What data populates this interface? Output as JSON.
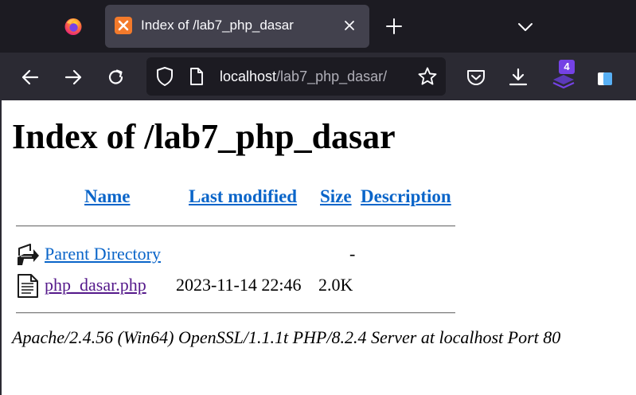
{
  "browser": {
    "tab": {
      "title": "Index of /lab7_php_dasar"
    },
    "url": {
      "host": "localhost",
      "path": "/lab7_php_dasar/"
    },
    "extension_badge": "4"
  },
  "page": {
    "heading": "Index of /lab7_php_dasar",
    "columns": {
      "name": "Name",
      "last_modified": "Last modified",
      "size": "Size",
      "description": "Description"
    },
    "rows": [
      {
        "name": "Parent Directory",
        "last_modified": "",
        "size": "-",
        "icon": "back-folder-icon"
      },
      {
        "name": "php_dasar.php",
        "last_modified": "2023-11-14 22:46",
        "size": "2.0K",
        "icon": "text-file-icon"
      }
    ],
    "address": "Apache/2.4.56 (Win64) OpenSSL/1.1.1t PHP/8.2.4 Server at localhost Port 80"
  },
  "colors": {
    "tabbar_bg": "#1c1b22",
    "navbar_bg": "#2b2a33",
    "link": "#0a65c9",
    "visited_link": "#551a8b",
    "badge": "#7542e5",
    "xampp_orange": "#f37a2b"
  }
}
